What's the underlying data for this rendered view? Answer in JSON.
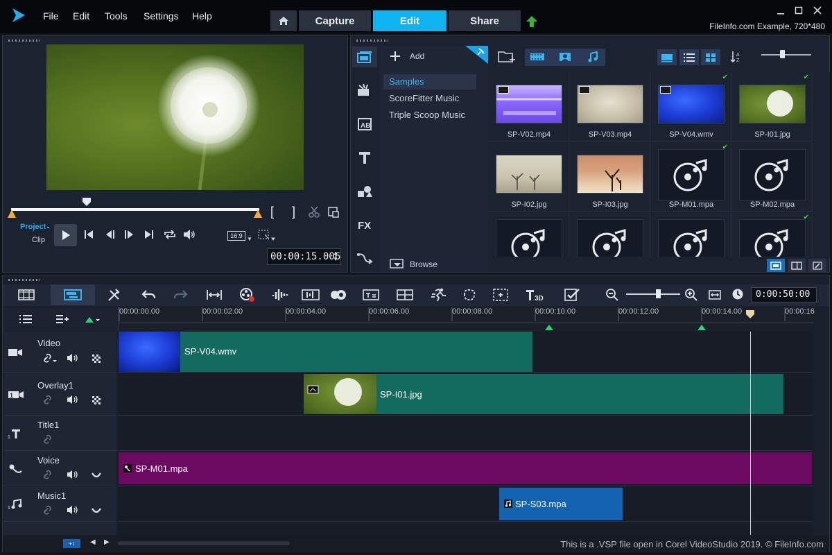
{
  "menu": {
    "items": [
      "File",
      "Edit",
      "Tools",
      "Settings",
      "Help"
    ]
  },
  "tabs": {
    "capture": "Capture",
    "edit": "Edit",
    "share": "Share"
  },
  "window": {
    "info": "FileInfo.com Example, 720*480"
  },
  "player": {
    "mode_project": "Project",
    "mode_clip": "Clip",
    "aspect": "16:9",
    "timecode": "00:00:15.006"
  },
  "library": {
    "add_label": "Add",
    "browse_label": "Browse",
    "categories": [
      "Samples",
      "ScoreFitter Music",
      "Triple Scoop Music"
    ],
    "tools": [
      "media-icon",
      "instant-project-icon",
      "transition-icon",
      "title-icon",
      "graphic-icon",
      "filter-icon",
      "path-icon"
    ],
    "items": [
      {
        "name": "SP-V02.mp4",
        "kind": "video",
        "checked": false
      },
      {
        "name": "SP-V03.mp4",
        "kind": "video",
        "checked": false
      },
      {
        "name": "SP-V04.wmv",
        "kind": "video",
        "checked": true
      },
      {
        "name": "SP-I01.jpg",
        "kind": "image",
        "checked": true
      },
      {
        "name": "SP-I02.jpg",
        "kind": "image",
        "checked": false
      },
      {
        "name": "SP-I03.jpg",
        "kind": "image",
        "checked": false
      },
      {
        "name": "SP-M01.mpa",
        "kind": "audio",
        "checked": true
      },
      {
        "name": "SP-M02.mpa",
        "kind": "audio",
        "checked": false
      },
      {
        "name": "",
        "kind": "audio",
        "checked": false
      },
      {
        "name": "",
        "kind": "audio",
        "checked": false
      },
      {
        "name": "",
        "kind": "audio",
        "checked": false
      },
      {
        "name": "",
        "kind": "audio",
        "checked": true
      }
    ]
  },
  "timeline": {
    "duration": "0:00:50:00",
    "ruler": [
      "00:00:00.00",
      "00:00:02.00",
      "00:00:04.00",
      "00:00:06.00",
      "00:00:08.00",
      "00:00:10.00",
      "00:00:12.00",
      "00:00:14.00",
      "00:00:16"
    ],
    "tracks": [
      {
        "name": "Video",
        "clips": [
          {
            "label": "SP-V04.wmv"
          }
        ]
      },
      {
        "name": "Overlay1",
        "clips": [
          {
            "label": "SP-I01.jpg"
          }
        ]
      },
      {
        "name": "Title1",
        "clips": []
      },
      {
        "name": "Voice",
        "clips": [
          {
            "label": "SP-M01.mpa"
          }
        ]
      },
      {
        "name": "Music1",
        "clips": [
          {
            "label": "SP-S03.mpa"
          }
        ]
      }
    ]
  },
  "status": {
    "text": "This is a .VSP file open in Corel VideoStudio 2019. © FileInfo.com"
  },
  "colors": {
    "accent": "#0fb3f2",
    "video_clip": "#136a5e",
    "voice_clip": "#6c0a62",
    "music_clip": "#1463b0",
    "bg": "#1b2230"
  }
}
